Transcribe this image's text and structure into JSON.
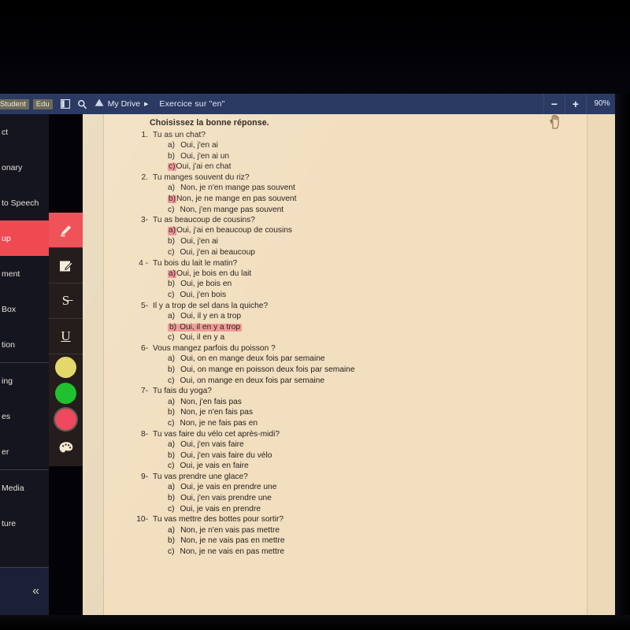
{
  "appbar": {
    "chips": [
      "Student",
      "Edu"
    ],
    "sidebar_toggle_icon": "panel-toggle-icon",
    "search_icon": "search-icon",
    "drive_icon": "google-drive-icon",
    "drive_label": "My Drive",
    "breadcrumb_separator": "▸",
    "document_title": "Exercice sur \"en\"",
    "zoom_out_label": "−",
    "zoom_in_label": "+",
    "zoom_level": "90%"
  },
  "tool_menu": {
    "items": [
      {
        "label": "ct",
        "name": "select",
        "active": false
      },
      {
        "label": "onary",
        "name": "dictionary",
        "active": false
      },
      {
        "label": "to Speech",
        "name": "text-to-speech",
        "active": false
      },
      {
        "label": "up",
        "name": "markup",
        "active": true
      },
      {
        "label": "ment",
        "name": "comment",
        "active": false
      },
      {
        "label": "Box",
        "name": "text-box",
        "active": false
      },
      {
        "label": "tion",
        "name": "equation",
        "active": false
      },
      {
        "label": "ing",
        "name": "drawing",
        "active": false
      },
      {
        "label": "es",
        "name": "shapes",
        "active": false
      },
      {
        "label": "er",
        "name": "eraser",
        "active": false
      },
      {
        "label": "Media",
        "name": "insert-media",
        "active": false
      },
      {
        "label": "ture",
        "name": "signature",
        "active": false
      }
    ],
    "collapse_label": "«"
  },
  "icon_strip": {
    "tools": [
      {
        "name": "highlighter-icon",
        "glyph": "",
        "active": true
      },
      {
        "name": "text-box-icon",
        "glyph": "",
        "active": false
      },
      {
        "name": "strikethrough-icon",
        "glyph": "S̶",
        "active": false
      },
      {
        "name": "underline-icon",
        "glyph": "U",
        "active": false
      }
    ],
    "colors": [
      {
        "name": "color-yellow",
        "hex": "#e3d96a",
        "selected": false
      },
      {
        "name": "color-green",
        "hex": "#1fc22e",
        "selected": false
      },
      {
        "name": "color-red",
        "hex": "#f0485c",
        "selected": true
      }
    ],
    "palette_icon": "color-palette-icon"
  },
  "document": {
    "heading": "Choisissez la bonne réponse.",
    "questions": [
      {
        "number": "1.",
        "text": "Tu as un chat?",
        "options": [
          {
            "label": "a)",
            "text": "Oui, j'en ai",
            "highlight": "none"
          },
          {
            "label": "b)",
            "text": "Oui, j'en ai un",
            "highlight": "none"
          },
          {
            "label": "c)",
            "text": "Oui, j'ai en chat",
            "highlight": "label"
          }
        ]
      },
      {
        "number": "2.",
        "text": "Tu manges souvent du riz?",
        "options": [
          {
            "label": "a)",
            "text": "Non, je n'en mange pas souvent",
            "highlight": "none"
          },
          {
            "label": "b)",
            "text": "Non, je ne mange en pas souvent",
            "highlight": "label"
          },
          {
            "label": "c)",
            "text": "Non, j'en mange pas souvent",
            "highlight": "none"
          }
        ]
      },
      {
        "number": "3-",
        "text": "Tu as beaucoup de cousins?",
        "options": [
          {
            "label": "a)",
            "text": "Oui, j'ai en beaucoup de cousins",
            "highlight": "label"
          },
          {
            "label": "b)",
            "text": "Oui, j'en ai",
            "highlight": "none"
          },
          {
            "label": "c)",
            "text": "Oui, j'en ai beaucoup",
            "highlight": "none"
          }
        ]
      },
      {
        "number": "4 -",
        "text": "Tu bois du lait le matin?",
        "options": [
          {
            "label": "a)",
            "text": "Oui, je bois en du lait",
            "highlight": "label"
          },
          {
            "label": "b)",
            "text": "Oui, je bois en",
            "highlight": "none"
          },
          {
            "label": "c)",
            "text": "Oui, j'en bois",
            "highlight": "none"
          }
        ]
      },
      {
        "number": "5-",
        "text": "Il y a trop de sel dans la quiche?",
        "options": [
          {
            "label": "a)",
            "text": "Oui, il y en a trop",
            "highlight": "none"
          },
          {
            "label": "b)",
            "text": "Oui, il en y a trop",
            "highlight": "full"
          },
          {
            "label": "c)",
            "text": "Oui, il en y a",
            "highlight": "none"
          }
        ]
      },
      {
        "number": "6-",
        "text": "Vous mangez parfois du poisson ?",
        "options": [
          {
            "label": "a)",
            "text": "Oui, on en mange deux fois par semaine",
            "highlight": "none"
          },
          {
            "label": "b)",
            "text": "Oui, on mange en poisson deux fois par semaine",
            "highlight": "none"
          },
          {
            "label": "c)",
            "text": "Oui, on mange en deux fois par semaine",
            "highlight": "none"
          }
        ]
      },
      {
        "number": "7-",
        "text": "Tu fais du yoga?",
        "options": [
          {
            "label": "a)",
            "text": "Non, j'en fais pas",
            "highlight": "none"
          },
          {
            "label": "b)",
            "text": "Non, je n'en fais pas",
            "highlight": "none"
          },
          {
            "label": "c)",
            "text": "Non, je ne fais pas en",
            "highlight": "none"
          }
        ]
      },
      {
        "number": "8-",
        "text": "Tu vas faire du vélo cet après-midi?",
        "options": [
          {
            "label": "a)",
            "text": "Oui, j'en vais faire",
            "highlight": "none"
          },
          {
            "label": "b)",
            "text": "Oui, j'en vais faire du vélo",
            "highlight": "none"
          },
          {
            "label": "c)",
            "text": "Oui, je vais en faire",
            "highlight": "none"
          }
        ]
      },
      {
        "number": "9-",
        "text": "Tu vas prendre une glace?",
        "options": [
          {
            "label": "a)",
            "text": "Oui, je vais en prendre une",
            "highlight": "none"
          },
          {
            "label": "b)",
            "text": "Oui, j'en vais prendre une",
            "highlight": "none"
          },
          {
            "label": "c)",
            "text": "Oui, je vais en prendre",
            "highlight": "none"
          }
        ]
      },
      {
        "number": "10-",
        "text": "Tu vas mettre des bottes pour sortir?",
        "options": [
          {
            "label": "a)",
            "text": "Non, je n'en vais pas mettre",
            "highlight": "none"
          },
          {
            "label": "b)",
            "text": "Non, je ne vais pas en mettre",
            "highlight": "none"
          },
          {
            "label": "c)",
            "text": "Non, je ne vais en pas mettre",
            "highlight": "none"
          }
        ]
      }
    ]
  }
}
